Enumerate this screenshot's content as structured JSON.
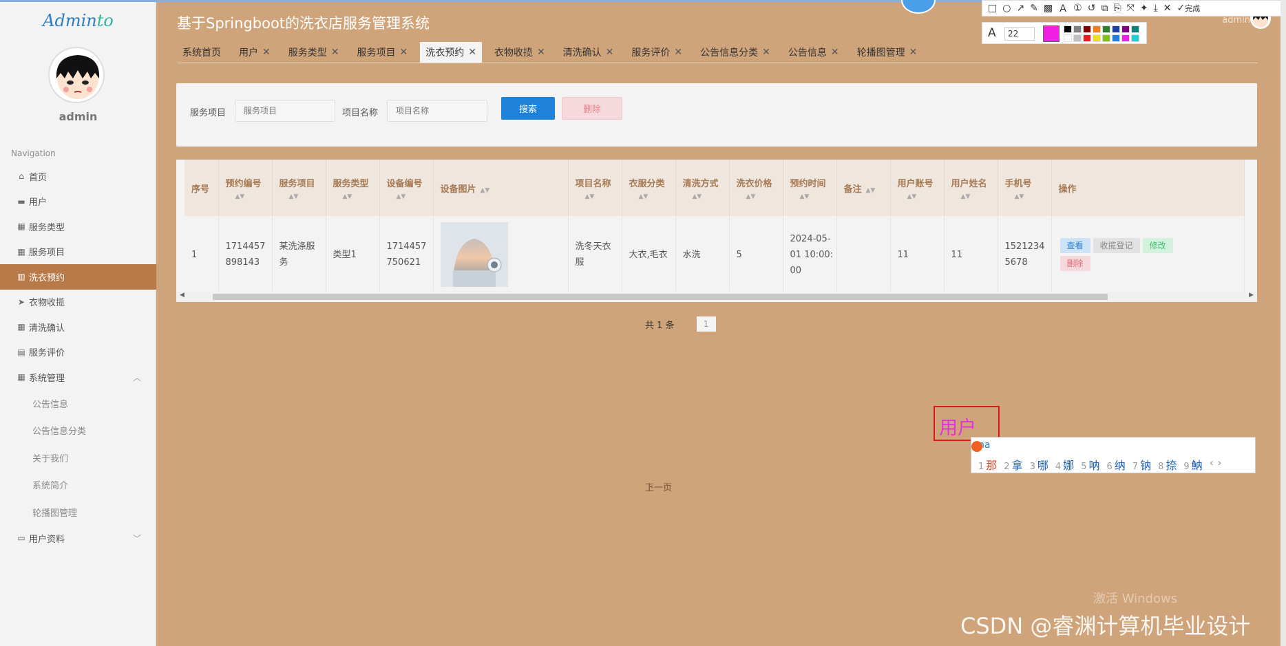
{
  "brand": {
    "logo_a": "Admin",
    "logo_b": "to",
    "username": "admin"
  },
  "nav": {
    "heading": "Navigation",
    "items": [
      {
        "label": "首页",
        "icon": "home-icon",
        "glyph": "⌂"
      },
      {
        "label": "用户",
        "icon": "monitor-icon",
        "glyph": "▬"
      },
      {
        "label": "服务类型",
        "icon": "grid-icon",
        "glyph": "▦"
      },
      {
        "label": "服务项目",
        "icon": "grid-icon",
        "glyph": "▦"
      },
      {
        "label": "洗衣预约",
        "icon": "book-icon",
        "glyph": "▥",
        "active": true
      },
      {
        "label": "衣物收揽",
        "icon": "send-icon",
        "glyph": "➤"
      },
      {
        "label": "清洗确认",
        "icon": "grid-icon",
        "glyph": "▦"
      },
      {
        "label": "服务评价",
        "icon": "clipboard-icon",
        "glyph": "▤"
      },
      {
        "label": "系统管理",
        "icon": "grid-icon",
        "glyph": "▦",
        "chevron": "︿"
      }
    ],
    "subitems": [
      "公告信息",
      "公告信息分类",
      "关于我们",
      "系统简介",
      "轮播图管理"
    ],
    "user_profile": {
      "label": "用户资料",
      "glyph": "▭",
      "chevron": "﹀"
    }
  },
  "header": {
    "title": "基于Springboot的洗衣店服务管理系统",
    "admin": "admin"
  },
  "tabs": [
    {
      "label": "系统首页",
      "close": false
    },
    {
      "label": "用户",
      "close": true
    },
    {
      "label": "服务类型",
      "close": true
    },
    {
      "label": "服务项目",
      "close": true
    },
    {
      "label": "洗衣预约",
      "close": true,
      "active": true
    },
    {
      "label": "衣物收揽",
      "close": true
    },
    {
      "label": "清洗确认",
      "close": true
    },
    {
      "label": "服务评价",
      "close": true
    },
    {
      "label": "公告信息分类",
      "close": true
    },
    {
      "label": "公告信息",
      "close": true
    },
    {
      "label": "轮播图管理",
      "close": true
    }
  ],
  "search": {
    "label1": "服务项目",
    "placeholder1": "服务项目",
    "label2": "项目名称",
    "placeholder2": "项目名称",
    "search_btn": "搜索",
    "delete_btn": "删除"
  },
  "table": {
    "columns": [
      {
        "label": "序号",
        "sort": false
      },
      {
        "label": "预约编号",
        "sort": true
      },
      {
        "label": "服务项目",
        "sort": true
      },
      {
        "label": "服务类型",
        "sort": true
      },
      {
        "label": "设备编号",
        "sort": true
      },
      {
        "label": "设备图片",
        "sort": true,
        "inline": true
      },
      {
        "label": "项目名称",
        "sort": true
      },
      {
        "label": "衣服分类",
        "sort": true
      },
      {
        "label": "清洗方式",
        "sort": true
      },
      {
        "label": "洗衣价格",
        "sort": true
      },
      {
        "label": "预约时间",
        "sort": true
      },
      {
        "label": "备注",
        "sort": true,
        "inline": true
      },
      {
        "label": "用户账号",
        "sort": true
      },
      {
        "label": "用户姓名",
        "sort": true
      },
      {
        "label": "手机号",
        "sort": true
      },
      {
        "label": "操作",
        "sort": false
      }
    ],
    "rows": [
      {
        "index": "1",
        "booking_no": "1714457898143",
        "service_item": "某洗涤服务",
        "service_type": "类型1",
        "device_no": "1714457750621",
        "project_name": "洗冬天衣服",
        "clothes_cat": "大衣,毛衣",
        "wash_method": "水洗",
        "price": "5",
        "time": "2024-05-01 10:00:00",
        "note": "",
        "account": "11",
        "name": "11",
        "phone": "15212345678"
      }
    ],
    "actions": {
      "view": "查看",
      "receive": "收揽登记",
      "edit": "修改",
      "delete": "删除"
    }
  },
  "pager": {
    "total": "共 1 条",
    "prev": "上一页",
    "page": "1",
    "next": "下一页"
  },
  "annotation": {
    "text": "用户",
    "ime_input": "na",
    "candidates": [
      {
        "n": "1",
        "c": "那"
      },
      {
        "n": "2",
        "c": "拿"
      },
      {
        "n": "3",
        "c": "哪"
      },
      {
        "n": "4",
        "c": "娜"
      },
      {
        "n": "5",
        "c": "呐"
      },
      {
        "n": "6",
        "c": "纳"
      },
      {
        "n": "7",
        "c": "钠"
      },
      {
        "n": "8",
        "c": "捺"
      },
      {
        "n": "9",
        "c": "魶"
      }
    ]
  },
  "shot_tool": {
    "font_size": "22",
    "done": "完成"
  },
  "watermark": "CSDN @睿渊计算机毕业设计",
  "activate": "激活 Windows",
  "colors": {
    "sidebar_active": "#b97a4a",
    "bg": "#d0a47a",
    "primary": "#1e82d8",
    "annot": "#e033d8"
  }
}
